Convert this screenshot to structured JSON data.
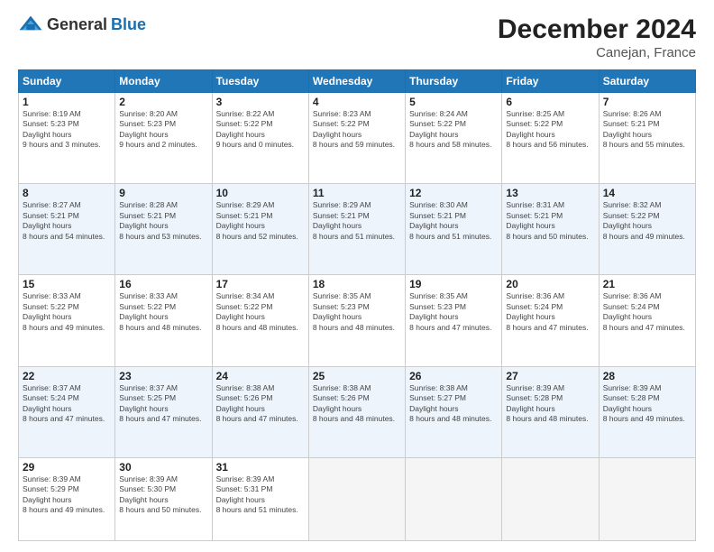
{
  "header": {
    "logo_general": "General",
    "logo_blue": "Blue",
    "month_title": "December 2024",
    "location": "Canejan, France"
  },
  "days_of_week": [
    "Sunday",
    "Monday",
    "Tuesday",
    "Wednesday",
    "Thursday",
    "Friday",
    "Saturday"
  ],
  "weeks": [
    [
      {
        "day": 1,
        "sunrise": "8:19 AM",
        "sunset": "5:23 PM",
        "daylight": "9 hours and 3 minutes."
      },
      {
        "day": 2,
        "sunrise": "8:20 AM",
        "sunset": "5:23 PM",
        "daylight": "9 hours and 2 minutes."
      },
      {
        "day": 3,
        "sunrise": "8:22 AM",
        "sunset": "5:22 PM",
        "daylight": "9 hours and 0 minutes."
      },
      {
        "day": 4,
        "sunrise": "8:23 AM",
        "sunset": "5:22 PM",
        "daylight": "8 hours and 59 minutes."
      },
      {
        "day": 5,
        "sunrise": "8:24 AM",
        "sunset": "5:22 PM",
        "daylight": "8 hours and 58 minutes."
      },
      {
        "day": 6,
        "sunrise": "8:25 AM",
        "sunset": "5:22 PM",
        "daylight": "8 hours and 56 minutes."
      },
      {
        "day": 7,
        "sunrise": "8:26 AM",
        "sunset": "5:21 PM",
        "daylight": "8 hours and 55 minutes."
      }
    ],
    [
      {
        "day": 8,
        "sunrise": "8:27 AM",
        "sunset": "5:21 PM",
        "daylight": "8 hours and 54 minutes."
      },
      {
        "day": 9,
        "sunrise": "8:28 AM",
        "sunset": "5:21 PM",
        "daylight": "8 hours and 53 minutes."
      },
      {
        "day": 10,
        "sunrise": "8:29 AM",
        "sunset": "5:21 PM",
        "daylight": "8 hours and 52 minutes."
      },
      {
        "day": 11,
        "sunrise": "8:29 AM",
        "sunset": "5:21 PM",
        "daylight": "8 hours and 51 minutes."
      },
      {
        "day": 12,
        "sunrise": "8:30 AM",
        "sunset": "5:21 PM",
        "daylight": "8 hours and 51 minutes."
      },
      {
        "day": 13,
        "sunrise": "8:31 AM",
        "sunset": "5:21 PM",
        "daylight": "8 hours and 50 minutes."
      },
      {
        "day": 14,
        "sunrise": "8:32 AM",
        "sunset": "5:22 PM",
        "daylight": "8 hours and 49 minutes."
      }
    ],
    [
      {
        "day": 15,
        "sunrise": "8:33 AM",
        "sunset": "5:22 PM",
        "daylight": "8 hours and 49 minutes."
      },
      {
        "day": 16,
        "sunrise": "8:33 AM",
        "sunset": "5:22 PM",
        "daylight": "8 hours and 48 minutes."
      },
      {
        "day": 17,
        "sunrise": "8:34 AM",
        "sunset": "5:22 PM",
        "daylight": "8 hours and 48 minutes."
      },
      {
        "day": 18,
        "sunrise": "8:35 AM",
        "sunset": "5:23 PM",
        "daylight": "8 hours and 48 minutes."
      },
      {
        "day": 19,
        "sunrise": "8:35 AM",
        "sunset": "5:23 PM",
        "daylight": "8 hours and 47 minutes."
      },
      {
        "day": 20,
        "sunrise": "8:36 AM",
        "sunset": "5:24 PM",
        "daylight": "8 hours and 47 minutes."
      },
      {
        "day": 21,
        "sunrise": "8:36 AM",
        "sunset": "5:24 PM",
        "daylight": "8 hours and 47 minutes."
      }
    ],
    [
      {
        "day": 22,
        "sunrise": "8:37 AM",
        "sunset": "5:24 PM",
        "daylight": "8 hours and 47 minutes."
      },
      {
        "day": 23,
        "sunrise": "8:37 AM",
        "sunset": "5:25 PM",
        "daylight": "8 hours and 47 minutes."
      },
      {
        "day": 24,
        "sunrise": "8:38 AM",
        "sunset": "5:26 PM",
        "daylight": "8 hours and 47 minutes."
      },
      {
        "day": 25,
        "sunrise": "8:38 AM",
        "sunset": "5:26 PM",
        "daylight": "8 hours and 48 minutes."
      },
      {
        "day": 26,
        "sunrise": "8:38 AM",
        "sunset": "5:27 PM",
        "daylight": "8 hours and 48 minutes."
      },
      {
        "day": 27,
        "sunrise": "8:39 AM",
        "sunset": "5:28 PM",
        "daylight": "8 hours and 48 minutes."
      },
      {
        "day": 28,
        "sunrise": "8:39 AM",
        "sunset": "5:28 PM",
        "daylight": "8 hours and 49 minutes."
      }
    ],
    [
      {
        "day": 29,
        "sunrise": "8:39 AM",
        "sunset": "5:29 PM",
        "daylight": "8 hours and 49 minutes."
      },
      {
        "day": 30,
        "sunrise": "8:39 AM",
        "sunset": "5:30 PM",
        "daylight": "8 hours and 50 minutes."
      },
      {
        "day": 31,
        "sunrise": "8:39 AM",
        "sunset": "5:31 PM",
        "daylight": "8 hours and 51 minutes."
      },
      null,
      null,
      null,
      null
    ]
  ]
}
